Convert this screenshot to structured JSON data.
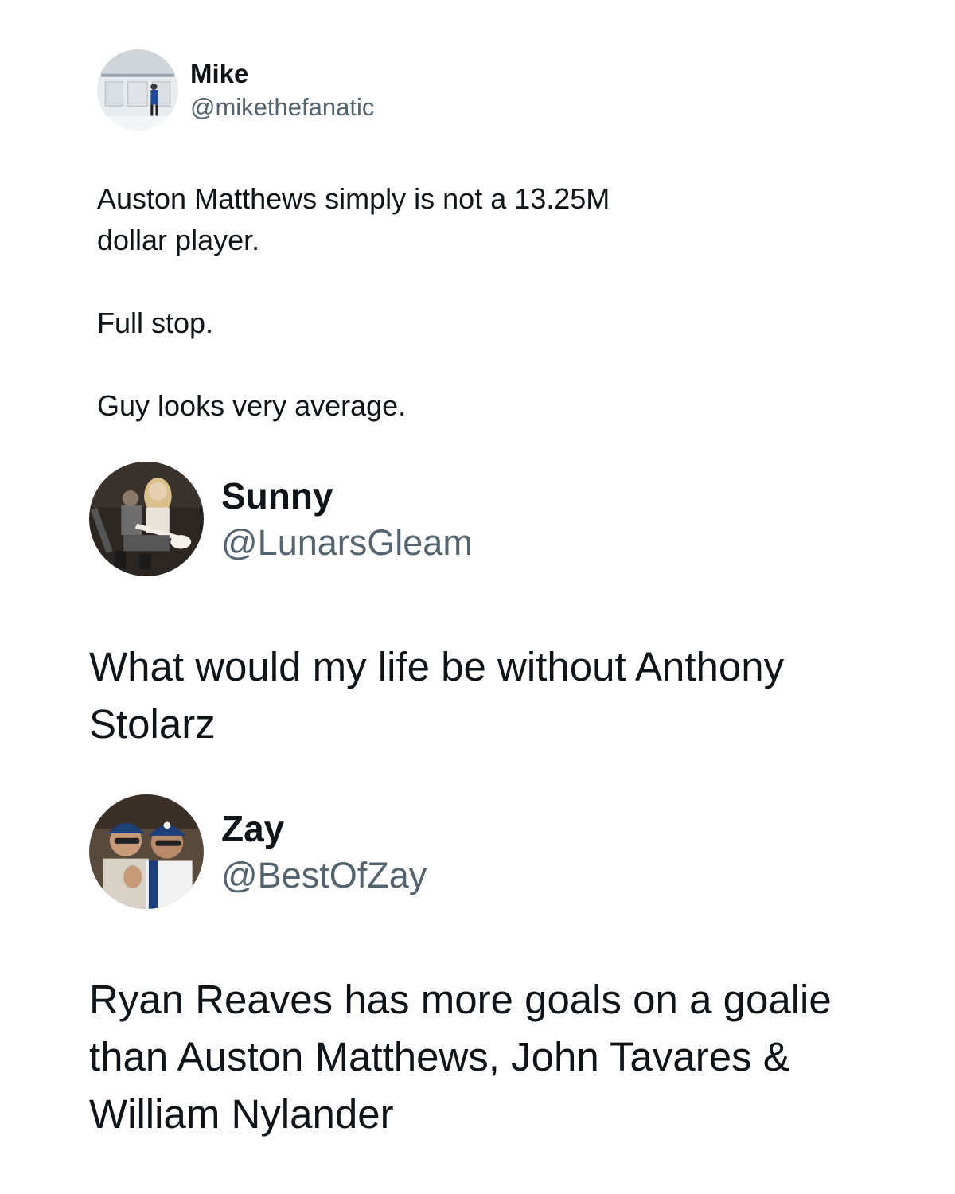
{
  "tweets": [
    {
      "name": "Mike",
      "handle": "@mikethefanatic",
      "avatar_icon": "stadium-photo-avatar",
      "paragraphs": [
        "Auston Matthews simply is not a 13.25M dollar player.",
        "Full stop.",
        "Guy looks very average."
      ]
    },
    {
      "name": "Sunny",
      "handle": "@LunarsGleam",
      "avatar_icon": "guitar-photo-avatar",
      "paragraphs": [
        "What would my life be without Anthony Stolarz"
      ]
    },
    {
      "name": "Zay",
      "handle": "@BestOfZay",
      "avatar_icon": "selfie-photo-avatar",
      "paragraphs": [
        "Ryan Reaves has more goals on a goalie than Auston Matthews, John Tavares & William Nylander"
      ]
    }
  ],
  "colors": {
    "text": "#0f1419",
    "handle": "#536471",
    "background": "#ffffff"
  }
}
